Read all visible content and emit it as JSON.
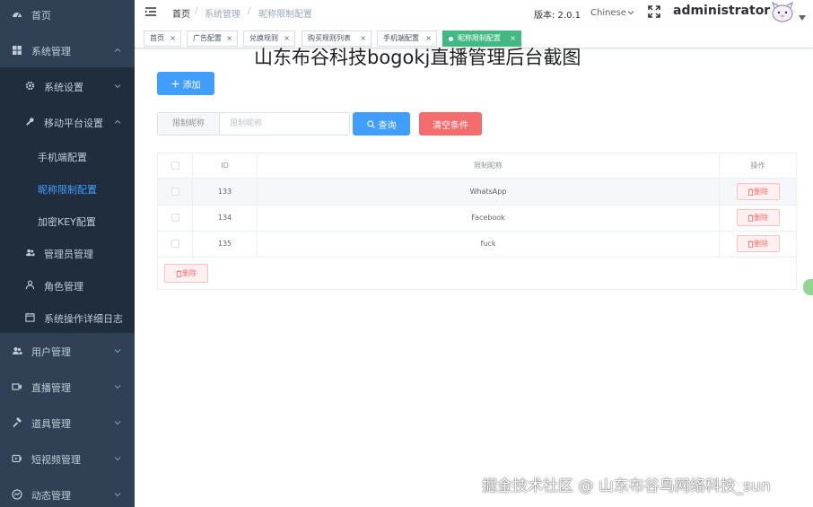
{
  "sidebar": {
    "home": "首页",
    "system_mgmt": "系统管理",
    "system_settings": "系统设置",
    "mobile_settings": "移动平台设置",
    "mobile_config": "手机端配置",
    "nickname_limit": "昵称限制配置",
    "encrypt_key": "加密KEY配置",
    "admin_mgmt": "管理员管理",
    "role_mgmt": "角色管理",
    "op_log": "系统操作详细日志",
    "user_mgmt": "用户管理",
    "live_mgmt": "直播管理",
    "prop_mgmt": "道具管理",
    "short_video_mgmt": "短视频管理",
    "dynamic_mgmt": "动态管理",
    "active_color": "#409eff",
    "bg_color": "#304156"
  },
  "header": {
    "breadcrumb": [
      "首页",
      "系统管理",
      "昵称限制配置"
    ],
    "separator": "/",
    "version": "版本: 2.0.1",
    "language": "Chinese",
    "username": "administrator"
  },
  "tags": [
    {
      "label": "首页",
      "close": "×"
    },
    {
      "label": "广告配置",
      "close": "×"
    },
    {
      "label": "兑换规则",
      "close": "×"
    },
    {
      "label": "购买规则列表",
      "close": "×"
    },
    {
      "label": "手机端配置",
      "close": "×"
    },
    {
      "label": "昵称限制配置",
      "close": "×",
      "active": true
    }
  ],
  "watermark_title": "山东布谷科技bogokj直播管理后台截图",
  "watermark_footer": "掘金技术社区 @ 山东布谷鸟网络科技_sun",
  "toolbar": {
    "add_label": "添加",
    "search_prepend": "限制昵称",
    "search_placeholder": "限制昵称",
    "search_label": "查询",
    "clear_label": "清空条件"
  },
  "table": {
    "headers": {
      "id": "ID",
      "name": "限制昵称",
      "op": "操作"
    },
    "rows": [
      {
        "id": "133",
        "name": "WhatsApp",
        "action": "删除"
      },
      {
        "id": "134",
        "name": "Facebook",
        "action": "删除"
      },
      {
        "id": "135",
        "name": "fuck",
        "action": "删除"
      }
    ],
    "bulk_delete": "删除"
  },
  "colors": {
    "primary": "#409eff",
    "danger": "#f56c6c",
    "tag_active": "#42b983"
  }
}
